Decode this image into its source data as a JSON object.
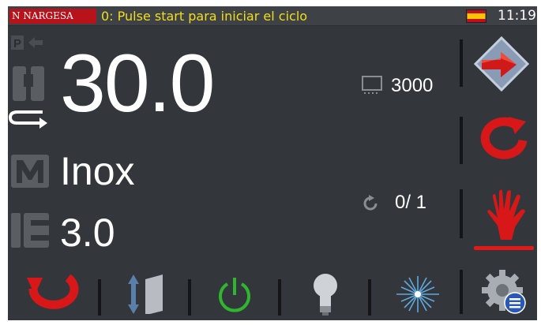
{
  "status_bar": {
    "brand": "N NARGESA",
    "message": "0: Pulse start para iniciar el ciclo",
    "time": "11:19",
    "flag_icon": "spain-flag-icon"
  },
  "main": {
    "length_value": "30.0",
    "material_value": "Inox",
    "thickness_value": "3.0",
    "count_value": "3000",
    "cycle_value": "0/ 1"
  },
  "right_panel": {
    "buttons": [
      "next-arrow-button",
      "repeat-button",
      "hand-stop-button"
    ]
  },
  "bottom_bar": {
    "buttons": [
      "return-button",
      "height-adjust-button",
      "power-button",
      "light-button",
      "laser-button",
      "settings-button"
    ]
  },
  "colors": {
    "background": "#33363b",
    "accent_red": "#e31818",
    "status_text": "#f2df1a",
    "power_green": "#2fb52f"
  }
}
